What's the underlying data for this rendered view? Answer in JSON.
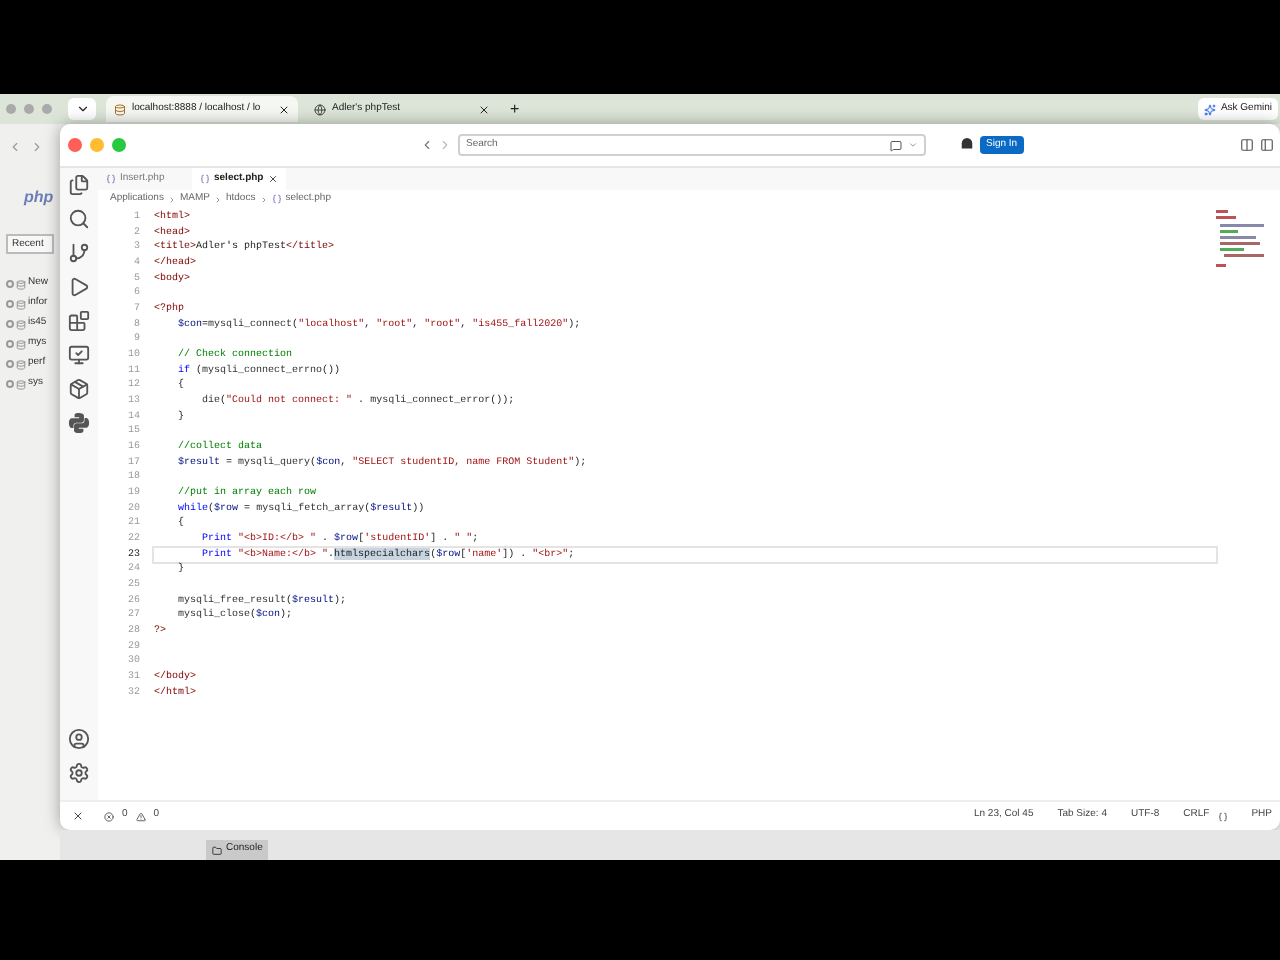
{
  "browser": {
    "tabs": [
      {
        "label": "localhost:8888 / localhost / lo",
        "selected": true
      },
      {
        "label": "Adler's phpTest",
        "selected": false
      }
    ],
    "new_tab": "+",
    "ask_button": "Ask Gemini",
    "sidebar": {
      "logo": "php",
      "recent": "Recent",
      "tree": [
        "New",
        "infor",
        "is45",
        "mys",
        "perf",
        "sys"
      ]
    },
    "console_tab": "Console"
  },
  "editor": {
    "search": {
      "placeholder": "Search"
    },
    "sign_in": "Sign In",
    "tabs": [
      {
        "label": "Insert.php",
        "selected": false
      },
      {
        "label": "select.php",
        "selected": true
      }
    ],
    "breadcrumbs": [
      "Applications",
      "MAMP",
      "htdocs",
      "select.php"
    ],
    "lines": [
      {
        "number": "1",
        "current": false,
        "kind": "top",
        "tokens": [
          {
            "kind": "tag",
            "text": "<html>"
          }
        ]
      },
      {
        "number": "2",
        "current": false,
        "kind": "top",
        "tokens": [
          {
            "kind": "tag",
            "text": "<head>"
          }
        ]
      },
      {
        "number": "3",
        "current": false,
        "kind": "top",
        "tokens": [
          {
            "kind": "tag",
            "text": "<title>"
          },
          {
            "kind": "plain",
            "text": "Adler's phpTest"
          },
          {
            "kind": "tag",
            "text": "</title>"
          }
        ]
      },
      {
        "number": "4",
        "current": false,
        "kind": "top",
        "tokens": [
          {
            "kind": "tag",
            "text": "</head>"
          }
        ]
      },
      {
        "number": "5",
        "current": false,
        "kind": "top",
        "tokens": [
          {
            "kind": "tag",
            "text": "<body>"
          }
        ]
      },
      {
        "number": "6",
        "current": false,
        "kind": "top"
      },
      {
        "number": "7",
        "current": false,
        "kind": "top",
        "tokens": [
          {
            "kind": "tag",
            "text": "<?php"
          }
        ]
      },
      {
        "number": "8",
        "current": false,
        "kind": "body",
        "tokens": [
          {
            "kind": "var",
            "text": "$con"
          },
          {
            "kind": "plain",
            "text": "="
          },
          {
            "kind": "func",
            "text": "mysqli_connect"
          },
          {
            "kind": "plain",
            "text": "("
          },
          {
            "kind": "string",
            "text": "\"localhost\""
          },
          {
            "kind": "plain",
            "text": ", "
          },
          {
            "kind": "string",
            "text": "\"root\""
          },
          {
            "kind": "plain",
            "text": ", "
          },
          {
            "kind": "string",
            "text": "\"root\""
          },
          {
            "kind": "plain",
            "text": ", "
          },
          {
            "kind": "string",
            "text": "\"is455_fall2020\""
          },
          {
            "kind": "plain",
            "text": ");"
          }
        ]
      },
      {
        "number": "9",
        "current": false,
        "kind": "top"
      },
      {
        "number": "10",
        "current": false,
        "kind": "body",
        "tokens": [
          {
            "kind": "comment",
            "text": "// Check connection"
          }
        ]
      },
      {
        "number": "11",
        "current": false,
        "kind": "body",
        "tokens": [
          {
            "kind": "keyword",
            "text": "if"
          },
          {
            "kind": "plain",
            "text": " ("
          },
          {
            "kind": "func",
            "text": "mysqli_connect_errno"
          },
          {
            "kind": "plain",
            "text": "())"
          }
        ]
      },
      {
        "number": "12",
        "current": false,
        "kind": "body",
        "tokens": [
          {
            "kind": "plain",
            "text": "{"
          }
        ]
      },
      {
        "number": "13",
        "current": false,
        "kind": "inner",
        "tokens": [
          {
            "kind": "func",
            "text": "die"
          },
          {
            "kind": "plain",
            "text": "("
          },
          {
            "kind": "string",
            "text": "\"Could not connect: \""
          },
          {
            "kind": "plain",
            "text": " . "
          },
          {
            "kind": "func",
            "text": "mysqli_connect_error"
          },
          {
            "kind": "plain",
            "text": "());"
          }
        ]
      },
      {
        "number": "14",
        "current": false,
        "kind": "body",
        "tokens": [
          {
            "kind": "plain",
            "text": "}"
          }
        ]
      },
      {
        "number": "15",
        "current": false,
        "kind": "top"
      },
      {
        "number": "16",
        "current": false,
        "kind": "body",
        "tokens": [
          {
            "kind": "comment",
            "text": "//collect data"
          }
        ]
      },
      {
        "number": "17",
        "current": false,
        "kind": "body",
        "tokens": [
          {
            "kind": "var",
            "text": "$result"
          },
          {
            "kind": "plain",
            "text": " = "
          },
          {
            "kind": "func",
            "text": "mysqli_query"
          },
          {
            "kind": "plain",
            "text": "("
          },
          {
            "kind": "var",
            "text": "$con"
          },
          {
            "kind": "plain",
            "text": ", "
          },
          {
            "kind": "string",
            "text": "\"SELECT studentID, name FROM Student\""
          },
          {
            "kind": "plain",
            "text": ");"
          }
        ]
      },
      {
        "number": "18",
        "current": false,
        "kind": "top"
      },
      {
        "number": "19",
        "current": false,
        "kind": "body",
        "tokens": [
          {
            "kind": "comment",
            "text": "//put in array each row"
          }
        ]
      },
      {
        "number": "20",
        "current": false,
        "kind": "body",
        "tokens": [
          {
            "kind": "keyword",
            "text": "while"
          },
          {
            "kind": "plain",
            "text": "("
          },
          {
            "kind": "var",
            "text": "$row"
          },
          {
            "kind": "plain",
            "text": " = "
          },
          {
            "kind": "func",
            "text": "mysqli_fetch_array"
          },
          {
            "kind": "plain",
            "text": "("
          },
          {
            "kind": "var",
            "text": "$result"
          },
          {
            "kind": "plain",
            "text": "))"
          }
        ]
      },
      {
        "number": "21",
        "current": false,
        "kind": "body",
        "tokens": [
          {
            "kind": "plain",
            "text": "{"
          }
        ]
      },
      {
        "number": "22",
        "current": false,
        "kind": "inner",
        "tokens": [
          {
            "kind": "keyword",
            "text": "Print "
          },
          {
            "kind": "string",
            "text": "\"<b>ID:</b> \""
          },
          {
            "kind": "plain",
            "text": " . "
          },
          {
            "kind": "var",
            "text": "$row"
          },
          {
            "kind": "plain",
            "text": "["
          },
          {
            "kind": "string",
            "text": "'studentID'"
          },
          {
            "kind": "plain",
            "text": "] . "
          },
          {
            "kind": "string",
            "text": "\" \""
          },
          {
            "kind": "plain",
            "text": ";"
          }
        ]
      },
      {
        "number": "23",
        "current": true,
        "kind": "inner",
        "tokens": [
          {
            "kind": "keyword",
            "text": "Print "
          },
          {
            "kind": "string",
            "text": "\"<b>Name:</b> \""
          },
          {
            "kind": "plain",
            "text": "."
          },
          {
            "kind": "highlighted",
            "text": "htmlspecialchars"
          },
          {
            "kind": "plain",
            "text": "("
          },
          {
            "kind": "var",
            "text": "$row"
          },
          {
            "kind": "plain",
            "text": "["
          },
          {
            "kind": "string",
            "text": "'name'"
          },
          {
            "kind": "plain",
            "text": "]) . "
          },
          {
            "kind": "string",
            "text": "\"<br>\""
          },
          {
            "kind": "plain",
            "text": ";"
          }
        ]
      },
      {
        "number": "24",
        "current": false,
        "kind": "body",
        "tokens": [
          {
            "kind": "plain",
            "text": "}"
          }
        ]
      },
      {
        "number": "25",
        "current": false,
        "kind": "top"
      },
      {
        "number": "26",
        "current": false,
        "kind": "body",
        "tokens": [
          {
            "kind": "func",
            "text": "mysqli_free_result"
          },
          {
            "kind": "plain",
            "text": "("
          },
          {
            "kind": "var",
            "text": "$result"
          },
          {
            "kind": "plain",
            "text": ");"
          }
        ]
      },
      {
        "number": "27",
        "current": false,
        "kind": "body",
        "tokens": [
          {
            "kind": "func",
            "text": "mysqli_close"
          },
          {
            "kind": "plain",
            "text": "("
          },
          {
            "kind": "var",
            "text": "$con"
          },
          {
            "kind": "plain",
            "text": ");"
          }
        ]
      },
      {
        "number": "28",
        "current": false,
        "kind": "top",
        "tokens": [
          {
            "kind": "tag",
            "text": "?>"
          }
        ]
      },
      {
        "number": "29",
        "current": false,
        "kind": "top"
      },
      {
        "number": "30",
        "current": false,
        "kind": "top"
      },
      {
        "number": "31",
        "current": false,
        "kind": "top",
        "tokens": [
          {
            "kind": "tag",
            "text": "</body>"
          }
        ]
      },
      {
        "number": "32",
        "current": false,
        "kind": "top",
        "tokens": [
          {
            "kind": "tag",
            "text": "</html>"
          }
        ]
      }
    ],
    "status_bar": {
      "errors": "0",
      "warnings": "0",
      "items": [
        "Ln 23, Col 45",
        "Tab Size: 4",
        "UTF-8",
        "CRLF",
        "PHP"
      ]
    }
  }
}
